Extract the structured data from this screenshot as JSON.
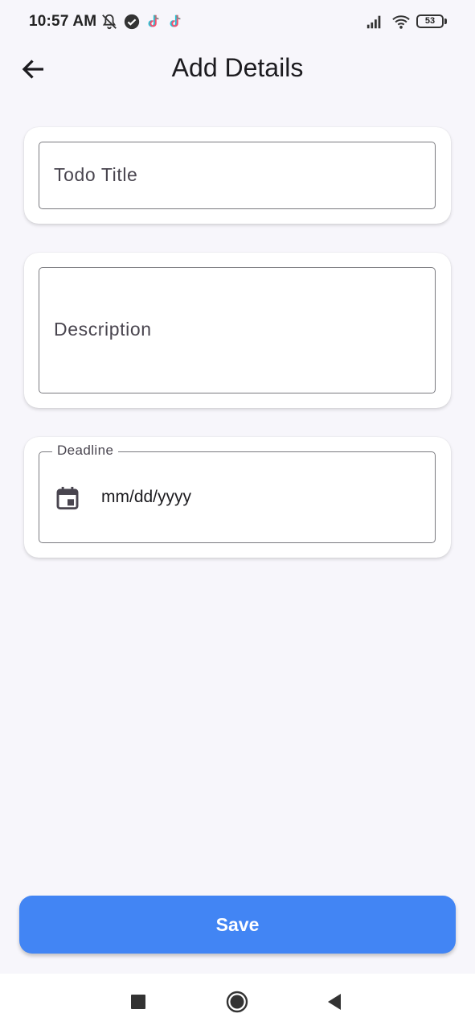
{
  "status_bar": {
    "time": "10:57 AM",
    "battery": "53",
    "icons": [
      "notifications-off-icon",
      "check-circle-icon",
      "tiktok-icon",
      "tiktok-icon",
      "signal-icon",
      "wifi-icon",
      "battery-icon"
    ]
  },
  "app_bar": {
    "title": "Add Details",
    "back_icon": "arrow-back-icon"
  },
  "form": {
    "title_placeholder": "Todo Title",
    "description_placeholder": "Description",
    "deadline_label": "Deadline",
    "deadline_value": "mm/dd/yyyy",
    "calendar_icon": "calendar-icon"
  },
  "actions": {
    "save_label": "Save"
  },
  "colors": {
    "primary": "#4285f4",
    "background": "#f7f6fb",
    "card": "#ffffff",
    "text": "#1c1b1f"
  },
  "nav_bar": {
    "icons": [
      "recents-square-icon",
      "home-circle-icon",
      "back-triangle-icon"
    ]
  }
}
